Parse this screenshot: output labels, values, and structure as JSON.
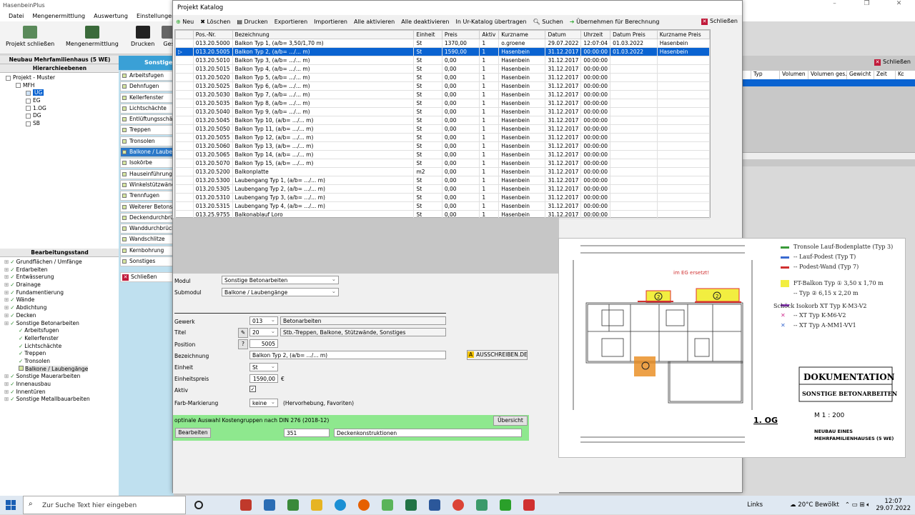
{
  "app": {
    "title": "HasenbeinPlus",
    "menu": [
      "Datei",
      "Mengenermittlung",
      "Auswertung",
      "Einstellungen",
      "Ka"
    ],
    "ribbon": [
      "Projekt schließen",
      "Mengenermittlung",
      "Drucken",
      "Ges"
    ]
  },
  "left": {
    "project_header": "Neubau Mehrfamilienhaus (5 WE)",
    "hier_header": "Hierarchieebenen",
    "tree": [
      {
        "label": "Projekt - Muster",
        "level": 0
      },
      {
        "label": "MFH",
        "level": 1
      },
      {
        "label": "UG",
        "level": 2,
        "selected": true
      },
      {
        "label": "EG",
        "level": 2
      },
      {
        "label": "1.OG",
        "level": 2
      },
      {
        "label": "DG",
        "level": 2
      },
      {
        "label": "SB",
        "level": 2
      }
    ],
    "bearb_header": "Bearbeitungsstand",
    "bearb": [
      {
        "label": "Grundflächen / Umfänge",
        "level": 0
      },
      {
        "label": "Erdarbeiten",
        "level": 0
      },
      {
        "label": "Entwässerung",
        "level": 0
      },
      {
        "label": "Drainage",
        "level": 0
      },
      {
        "label": "Fundamentierung",
        "level": 0
      },
      {
        "label": "Wände",
        "level": 0
      },
      {
        "label": "Abdichtung",
        "level": 0
      },
      {
        "label": "Decken",
        "level": 0
      },
      {
        "label": "Sonstige Betonarbeiten",
        "level": 0
      },
      {
        "label": "Arbeitsfugen",
        "level": 1
      },
      {
        "label": "Kellerfenster",
        "level": 1
      },
      {
        "label": "Lichtschächte",
        "level": 1
      },
      {
        "label": "Treppen",
        "level": 1
      },
      {
        "label": "Tronsolen",
        "level": 1
      },
      {
        "label": "Balkone / Laubengänge",
        "level": 1
      },
      {
        "label": "Sonstige Mauerarbeiten",
        "level": 0
      },
      {
        "label": "Innenausbau",
        "level": 0
      },
      {
        "label": "Innentüren",
        "level": 0
      },
      {
        "label": "Sonstige Metallbauarbeiten",
        "level": 0
      }
    ]
  },
  "modules": {
    "header": "Sonstige B",
    "items": [
      "Arbeitsfugen",
      "Dehnfugen",
      "Kellerfenster",
      "Lichtschächte",
      "Entlüftungsschäch",
      "Treppen",
      "Tronsolen",
      "Balkone / Laubeng",
      "Isokörbe",
      "Hauseinführung /",
      "Winkelstützwände",
      "Trennfugen",
      "Weiterer Betonsta",
      "Deckendurchbrü",
      "Wanddurchbrüche",
      "Wandschlitze",
      "Kernbohrung",
      "Sonstiges"
    ],
    "close": "Schließen"
  },
  "rightpanel": {
    "close": "Schließen",
    "cols": [
      "Typ",
      "Volumen",
      "Volumen ges.",
      "Gewicht",
      "Zeit",
      "Ko"
    ]
  },
  "katalog": {
    "title": "Projekt Katalog",
    "toolbar": [
      "Neu",
      "Löschen",
      "Drucken",
      "Exportieren",
      "Importieren",
      "Alle aktivieren",
      "Alle deaktivieren",
      "In Ur-Katalog übertragen",
      "Suchen",
      "Übernehmen für Berechnung"
    ],
    "close": "Schließen",
    "columns": [
      "Pos.-Nr.",
      "Bezeichnung",
      "Einheit",
      "Preis",
      "Aktiv",
      "Kurzname",
      "Datum",
      "Uhrzeit",
      "Datum Preis",
      "Kurzname Preis"
    ],
    "rows": [
      [
        "013.20.5000",
        "Balkon Typ 1, (a/b= 3,50/1,70 m)",
        "St",
        "1370,00",
        "1",
        "o.groene",
        "29.07.2022",
        "12:07:04",
        "01.03.2022",
        "Hasenbein"
      ],
      [
        "013.20.5005",
        "Balkon Typ 2, (a/b= .../... m)",
        "St",
        "1590,00",
        "1",
        "Hasenbein",
        "31.12.2017",
        "00:00:00",
        "01.03.2022",
        "Hasenbein"
      ],
      [
        "013.20.5010",
        "Balkon Typ 3, (a/b= .../... m)",
        "St",
        "0,00",
        "1",
        "Hasenbein",
        "31.12.2017",
        "00:00:00",
        "",
        ""
      ],
      [
        "013.20.5015",
        "Balkon Typ 4, (a/b= .../... m)",
        "St",
        "0,00",
        "1",
        "Hasenbein",
        "31.12.2017",
        "00:00:00",
        "",
        ""
      ],
      [
        "013.20.5020",
        "Balkon Typ 5, (a/b= .../... m)",
        "St",
        "0,00",
        "1",
        "Hasenbein",
        "31.12.2017",
        "00:00:00",
        "",
        ""
      ],
      [
        "013.20.5025",
        "Balkon Typ 6, (a/b= .../... m)",
        "St",
        "0,00",
        "1",
        "Hasenbein",
        "31.12.2017",
        "00:00:00",
        "",
        ""
      ],
      [
        "013.20.5030",
        "Balkon Typ 7, (a/b= .../... m)",
        "St",
        "0,00",
        "1",
        "Hasenbein",
        "31.12.2017",
        "00:00:00",
        "",
        ""
      ],
      [
        "013.20.5035",
        "Balkon Typ 8, (a/b= .../... m)",
        "St",
        "0,00",
        "1",
        "Hasenbein",
        "31.12.2017",
        "00:00:00",
        "",
        ""
      ],
      [
        "013.20.5040",
        "Balkon Typ 9, (a/b= .../... m)",
        "St",
        "0,00",
        "1",
        "Hasenbein",
        "31.12.2017",
        "00:00:00",
        "",
        ""
      ],
      [
        "013.20.5045",
        "Balkon Typ 10, (a/b= .../... m)",
        "St",
        "0,00",
        "1",
        "Hasenbein",
        "31.12.2017",
        "00:00:00",
        "",
        ""
      ],
      [
        "013.20.5050",
        "Balkon Typ 11, (a/b= .../... m)",
        "St",
        "0,00",
        "1",
        "Hasenbein",
        "31.12.2017",
        "00:00:00",
        "",
        ""
      ],
      [
        "013.20.5055",
        "Balkon Typ 12, (a/b= .../... m)",
        "St",
        "0,00",
        "1",
        "Hasenbein",
        "31.12.2017",
        "00:00:00",
        "",
        ""
      ],
      [
        "013.20.5060",
        "Balkon Typ 13, (a/b= .../... m)",
        "St",
        "0,00",
        "1",
        "Hasenbein",
        "31.12.2017",
        "00:00:00",
        "",
        ""
      ],
      [
        "013.20.5065",
        "Balkon Typ 14, (a/b= .../... m)",
        "St",
        "0,00",
        "1",
        "Hasenbein",
        "31.12.2017",
        "00:00:00",
        "",
        ""
      ],
      [
        "013.20.5070",
        "Balkon Typ 15, (a/b= .../... m)",
        "St",
        "0,00",
        "1",
        "Hasenbein",
        "31.12.2017",
        "00:00:00",
        "",
        ""
      ],
      [
        "013.20.5200",
        "Balkonplatte",
        "m2",
        "0,00",
        "1",
        "Hasenbein",
        "31.12.2017",
        "00:00:00",
        "",
        ""
      ],
      [
        "013.20.5300",
        "Laubengang Typ 1, (a/b= .../... m)",
        "St",
        "0,00",
        "1",
        "Hasenbein",
        "31.12.2017",
        "00:00:00",
        "",
        ""
      ],
      [
        "013.20.5305",
        "Laubengang Typ 2, (a/b= .../... m)",
        "St",
        "0,00",
        "1",
        "Hasenbein",
        "31.12.2017",
        "00:00:00",
        "",
        ""
      ],
      [
        "013.20.5310",
        "Laubengang Typ 3, (a/b= .../... m)",
        "St",
        "0,00",
        "1",
        "Hasenbein",
        "31.12.2017",
        "00:00:00",
        "",
        ""
      ],
      [
        "013.20.5315",
        "Laubengang Typ 4, (a/b= .../... m)",
        "St",
        "0,00",
        "1",
        "Hasenbein",
        "31.12.2017",
        "00:00:00",
        "",
        ""
      ],
      [
        "013.25.9755",
        "Balkonablauf Loro",
        "St",
        "0,00",
        "1",
        "Hasenbein",
        "31.12.2017",
        "00:00:00",
        "",
        ""
      ]
    ]
  },
  "form": {
    "modul_label": "Modul",
    "modul": "Sonstige Betonarbeiten",
    "submodul_label": "Submodul",
    "submodul": "Balkone / Laubengänge",
    "gewerk_label": "Gewerk",
    "gewerk_code": "013",
    "gewerk_name": "Betonarbeiten",
    "titel_label": "Titel",
    "titel_code": "20",
    "titel_name": "Stb.-Treppen, Balkone, Stützwände, Sonstiges",
    "position_label": "Position",
    "position": "5005",
    "bez_label": "Bezeichnung",
    "bezeichnung": "Balkon Typ 2, (a/b= .../... m)",
    "ausschreiben": "AUSSCHREIBEN.DE",
    "einheit_label": "Einheit",
    "einheit": "St",
    "ep_label": "Einheitspreis",
    "einheitspreis": "1590,00",
    "currency": "€",
    "aktiv_label": "Aktiv",
    "farb_label": "Farb-Markierung",
    "farb": "keine",
    "farb_hint": "(Hervorhebung, Favoriten)",
    "kosten_text": "optinale Auswahl Kostengruppen nach DIN 276 (2018-12)",
    "uebersicht": "Übersicht",
    "bearbeiten": "Bearbeiten",
    "kg_code": "351",
    "kg_name": "Deckenkonstruktionen"
  },
  "drawing": {
    "legend": [
      "Tronsole Lauf-Bodenplatte (Typ 3)",
      "-- Lauf-Podest (Typ T)",
      "-- Podest-Wand (Typ 7)",
      "FT-Balkon Typ ① 3,50 x 1,70 m",
      "-- Typ ② 6,15 x 2,20 m",
      "Schöck Isokorb XT Typ K-M3-V2",
      "-- XT Typ K-M6-V2",
      "-- XT Typ A-MM1-VV1"
    ],
    "doc_title": "DOKUMENTATION",
    "doc_sub": "SONSTIGE BETONARBEITEN",
    "scale": "M 1 : 200",
    "floor": "1. OG",
    "project": "NEUBAU EINES MEHRFAMILIENHAUSES (5 WE)",
    "note": "im EG ersetzt!"
  },
  "taskbar": {
    "search": "Zur Suche Text hier eingeben",
    "links": "Links",
    "weather": "20°C Bewölkt",
    "time": "12:07",
    "date": "29.07.2022"
  }
}
